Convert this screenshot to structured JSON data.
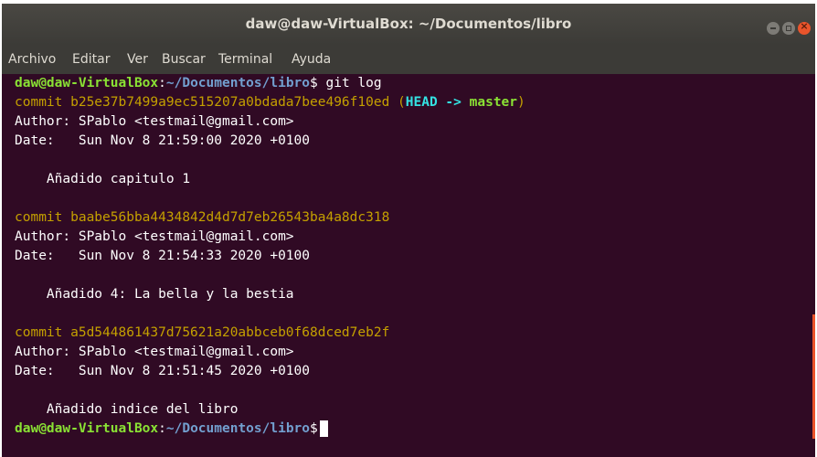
{
  "window": {
    "title": "daw@daw-VirtualBox: ~/Documentos/libro"
  },
  "menu": [
    "Archivo",
    "Editar",
    "Ver",
    "Buscar",
    "Terminal",
    "Ayuda"
  ],
  "prompt": {
    "user_host": "daw@daw-VirtualBox",
    "colon": ":",
    "path": "~/Documentos/libro",
    "symbol": "$"
  },
  "command": " git log",
  "commits": [
    {
      "commit_line": "commit b25e37b7499a9ec515207a0bdada7bee496f10ed",
      "open_paren": " (",
      "head": "HEAD -> ",
      "branch": "master",
      "close_paren": ")",
      "author": "Author: SPablo <testmail@gmail.com>",
      "date": "Date:   Sun Nov 8 21:59:00 2020 +0100",
      "message": "    Añadido capitulo 1"
    },
    {
      "commit_line": "commit baabe56bba4434842d4d7d7eb26543ba4a8dc318",
      "author": "Author: SPablo <testmail@gmail.com>",
      "date": "Date:   Sun Nov 8 21:54:33 2020 +0100",
      "message": "    Añadido 4: La bella y la bestia"
    },
    {
      "commit_line": "commit a5d544861437d75621a20abbceb0f68dced7eb2f",
      "author": "Author: SPablo <testmail@gmail.com>",
      "date": "Date:   Sun Nov 8 21:51:45 2020 +0100",
      "message": "    Añadido indice del libro"
    }
  ],
  "colors": {
    "background": "#300a24",
    "prompt_user": "#8ae234",
    "prompt_path": "#729fcf",
    "commit_hash": "#c4a000",
    "head": "#34e2e2",
    "branch": "#8ae234",
    "close_button": "#e9542b"
  },
  "icons": [
    "minimize-icon",
    "maximize-icon",
    "close-icon"
  ]
}
